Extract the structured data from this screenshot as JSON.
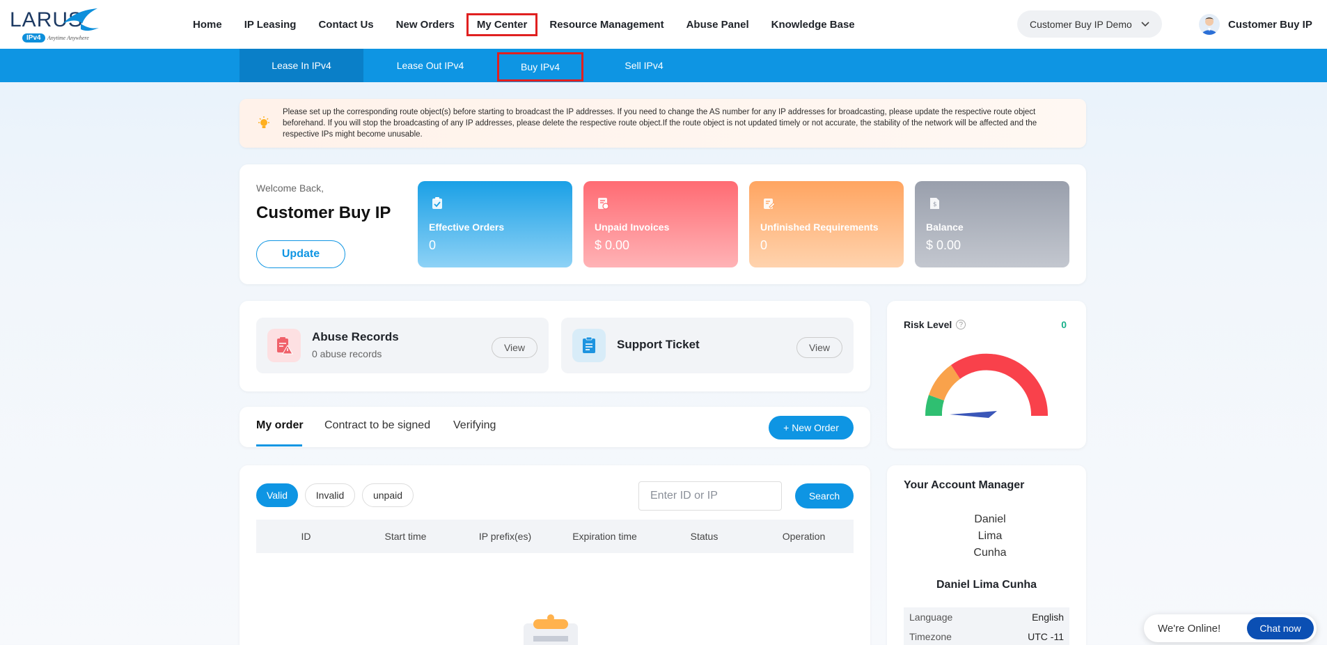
{
  "brand": {
    "logo_text": "LARUS",
    "logo_badge": "IPv4",
    "logo_tagline": "Anytime Anywhere"
  },
  "main_nav": [
    {
      "label": "Home"
    },
    {
      "label": "IP Leasing"
    },
    {
      "label": "Contact Us"
    },
    {
      "label": "New Orders"
    },
    {
      "label": "My Center"
    },
    {
      "label": "Resource Management"
    },
    {
      "label": "Abuse Panel"
    },
    {
      "label": "Knowledge Base"
    }
  ],
  "org_select": {
    "value": "Customer Buy IP Demo"
  },
  "user": {
    "name": "Customer Buy IP"
  },
  "sub_nav": [
    {
      "label": "Lease In IPv4"
    },
    {
      "label": "Lease Out IPv4"
    },
    {
      "label": "Buy IPv4"
    },
    {
      "label": "Sell IPv4"
    }
  ],
  "notice": {
    "text": "Please set up the corresponding route object(s) before starting to broadcast the IP addresses. If you need to change the AS number for any IP addresses for broadcasting, please update the respective route object beforehand. If you will stop the broadcasting of any IP addresses, please delete the respective route object.If the route object is not updated timely or not accurate, the stability of the network will be affected and the respective IPs might become unusable."
  },
  "welcome": {
    "label": "Welcome Back,",
    "name": "Customer Buy IP",
    "update_button": "Update"
  },
  "stats": [
    {
      "label": "Effective Orders",
      "value": "0"
    },
    {
      "label": "Unpaid Invoices",
      "value": "$ 0.00"
    },
    {
      "label": "Unfinished Requirements",
      "value": "0"
    },
    {
      "label": "Balance",
      "value": "$ 0.00"
    }
  ],
  "records": {
    "abuse": {
      "title": "Abuse Records",
      "subtitle": "0 abuse records",
      "button": "View"
    },
    "support": {
      "title": "Support Ticket",
      "button": "View"
    }
  },
  "risk": {
    "title": "Risk Level",
    "help": "?",
    "value": "0"
  },
  "order_tabs": {
    "tabs": [
      {
        "label": "My order"
      },
      {
        "label": "Contract to be signed"
      },
      {
        "label": "Verifying"
      }
    ],
    "new_order_button": "+ New Order"
  },
  "orders": {
    "filters": [
      {
        "label": "Valid"
      },
      {
        "label": "Invalid"
      },
      {
        "label": "unpaid"
      }
    ],
    "search_placeholder": "Enter ID or IP",
    "search_button": "Search",
    "columns": [
      "ID",
      "Start time",
      "IP prefix(es)",
      "Expiration time",
      "Status",
      "Operation"
    ]
  },
  "manager": {
    "title": "Your Account Manager",
    "photo_alt_lines": [
      "Daniel",
      "Lima",
      "Cunha"
    ],
    "name": "Daniel Lima Cunha",
    "rows": [
      {
        "key": "Language",
        "value": "English"
      },
      {
        "key": "Timezone",
        "value": "UTC -11"
      }
    ]
  },
  "chat": {
    "status": "We're Online!",
    "button": "Chat now"
  },
  "colors": {
    "primary": "#0e95e3",
    "highlight_box": "#e02020",
    "risk_value": "#19b08a"
  }
}
